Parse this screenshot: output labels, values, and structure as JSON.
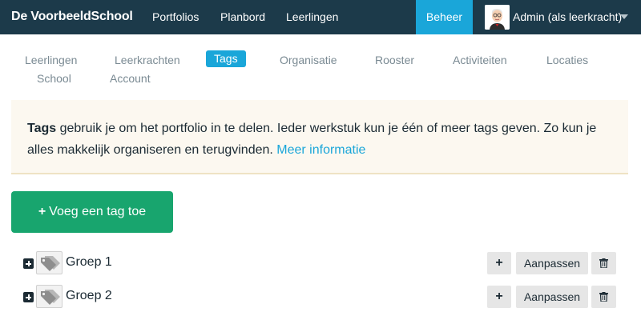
{
  "header": {
    "brand": "De VoorbeeldSchool",
    "nav": [
      "Portfolios",
      "Planbord",
      "Leerlingen"
    ],
    "admin_label": "Beheer",
    "user_label": "Admin (als leerkracht)"
  },
  "subnav": {
    "items": [
      "Leerlingen",
      "Leerkrachten",
      "Tags",
      "Organisatie",
      "Rooster",
      "Activiteiten",
      "Locaties",
      "School",
      "Account"
    ],
    "active": "Tags"
  },
  "info": {
    "bold": "Tags",
    "text": " gebruik je om het portfolio in te delen. Ieder werkstuk kun je één of meer tags geven. Zo kun je alles makkelijk organiseren en terugvinden. ",
    "link": "Meer informatie"
  },
  "add_button": {
    "plus": "+",
    "label": "Voeg een tag toe"
  },
  "tags": [
    {
      "name": "Groep 1"
    },
    {
      "name": "Groep 2"
    }
  ],
  "actions": {
    "add": "+",
    "edit": "Aanpassen"
  },
  "icons": {
    "expand": "plus-square-icon",
    "tag": "tags-icon",
    "delete": "trash-icon",
    "menu": "chevron-down-icon"
  },
  "colors": {
    "topbar": "#1c3a4a",
    "accent": "#1aa6d9",
    "success": "#18a56e",
    "info_bg": "#fcf8f0"
  }
}
